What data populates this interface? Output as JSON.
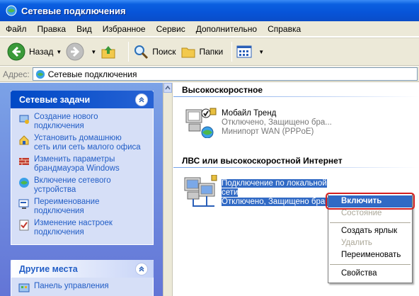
{
  "window": {
    "title": "Сетевые подключения"
  },
  "menu": [
    "Файл",
    "Правка",
    "Вид",
    "Избранное",
    "Сервис",
    "Дополнительно",
    "Справка"
  ],
  "toolbar": {
    "back": "Назад",
    "search": "Поиск",
    "folders": "Папки"
  },
  "address": {
    "label": "Адрес:",
    "value": "Сетевые подключения"
  },
  "network_tasks": {
    "title": "Сетевые задачи",
    "items": [
      {
        "line1": "Создание нового",
        "line2": "подключения"
      },
      {
        "line1": "Установить домашнюю",
        "line2": "сеть или сеть малого офиса"
      },
      {
        "line1": "Изменить параметры",
        "line2": "брандмауэра Windows"
      },
      {
        "line1": "Включение сетевого",
        "line2": "устройства"
      },
      {
        "line1": "Переименование",
        "line2": "подключения"
      },
      {
        "line1": "Изменение настроек",
        "line2": "подключения"
      }
    ]
  },
  "other_places": {
    "title": "Другие места",
    "items": [
      "Панель управления"
    ]
  },
  "groups": {
    "broadband": {
      "title": "Высокоскоростное",
      "connection": {
        "name": "Мобайл Тренд",
        "status": "Отключено, Защищено бра...",
        "device": "Минипорт WAN (PPPoE)"
      }
    },
    "lan": {
      "title": "ЛВС или высокоскоростной Интернет",
      "connection": {
        "name_line1": "Подключение по локальной",
        "name_line2": "сети",
        "status": "Отключено, Защищено бра..."
      }
    }
  },
  "context_menu": {
    "items": {
      "enable": "Включить",
      "status": "Состояние",
      "shortcut": "Создать ярлык",
      "delete": "Удалить",
      "rename": "Переименовать",
      "properties": "Свойства"
    }
  },
  "colors": {
    "titlebar": "#0754d8",
    "selection": "#316ac5",
    "highlight_box": "#d51f1f",
    "link": "#215dc6"
  }
}
